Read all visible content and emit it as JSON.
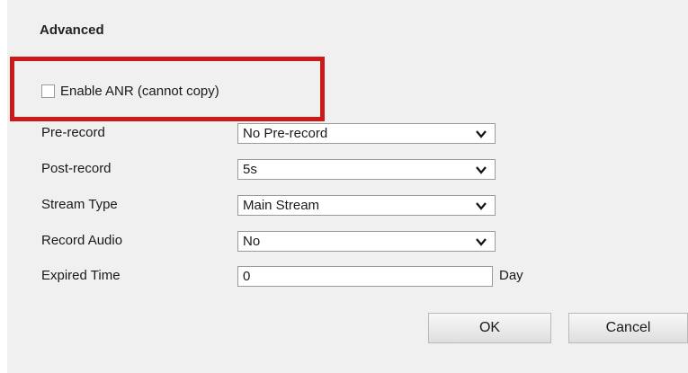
{
  "section": {
    "title": "Advanced"
  },
  "anr": {
    "label": "Enable ANR (cannot copy)",
    "checked": false,
    "highlight_color": "#cc1a1a"
  },
  "fields": {
    "pre_record": {
      "label": "Pre-record",
      "value": "No Pre-record"
    },
    "post_record": {
      "label": "Post-record",
      "value": "5s"
    },
    "stream_type": {
      "label": "Stream Type",
      "value": "Main Stream"
    },
    "record_audio": {
      "label": "Record Audio",
      "value": "No"
    },
    "expired_time": {
      "label": "Expired Time",
      "value": "0",
      "unit": "Day"
    }
  },
  "buttons": {
    "ok": "OK",
    "cancel": "Cancel"
  },
  "icons": {
    "select_arrow": "chevron-down-icon"
  }
}
